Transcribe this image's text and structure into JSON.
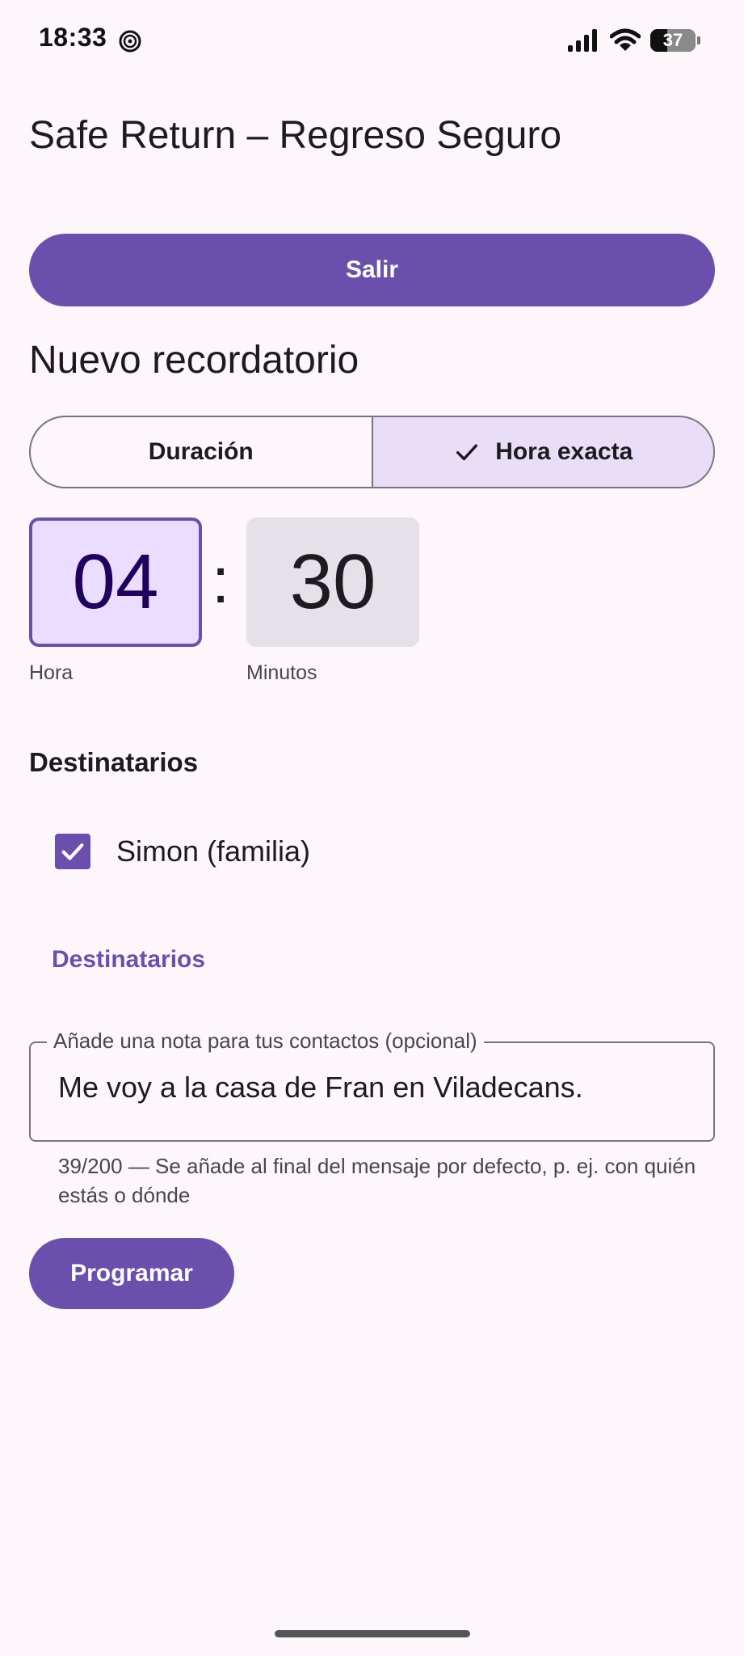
{
  "status_bar": {
    "time": "18:33",
    "battery_level": "37",
    "battery_percent": 37,
    "icons": [
      "app-spiral-icon",
      "signal-icon",
      "wifi-icon",
      "battery-icon"
    ]
  },
  "header": {
    "title": "Safe Return – Regreso Seguro"
  },
  "actions": {
    "exit_label": "Salir",
    "schedule_label": "Programar"
  },
  "reminder": {
    "heading": "Nuevo recordatorio",
    "mode_tabs": [
      {
        "label": "Duración",
        "selected": false
      },
      {
        "label": "Hora exacta",
        "selected": true
      }
    ],
    "time": {
      "hour": "04",
      "minutes": "30",
      "separator": ":",
      "hour_label": "Hora",
      "minutes_label": "Minutos"
    }
  },
  "recipients": {
    "heading": "Destinatarios",
    "contacts": [
      {
        "name": "Simon (familia)",
        "checked": true
      }
    ],
    "link_label": "Destinatarios"
  },
  "note": {
    "label": "Añade una nota para tus contactos (opcional)",
    "value": "Me voy a la casa de Fran en Viladecans.",
    "helper": "39/200 — Se añade al final del mensaje por defecto, p. ej. con quién estás o dónde"
  },
  "colors": {
    "primary": "#6b4fad",
    "background": "#fdf7fc",
    "selected_segment": "#e8def8",
    "hour_box": "#eaddff",
    "minute_box": "#e6e0e9"
  }
}
